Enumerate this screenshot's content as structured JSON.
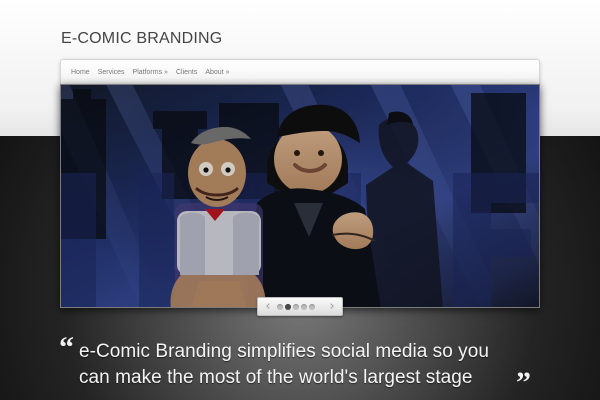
{
  "site": {
    "title": "E-COMIC BRANDING"
  },
  "nav": {
    "items": [
      {
        "label": "Home"
      },
      {
        "label": "Services"
      },
      {
        "label": "Platforms »"
      },
      {
        "label": "Clients"
      },
      {
        "label": "About »"
      }
    ]
  },
  "hero": {
    "alt": "Comedian on stage with a ventriloquist puppet"
  },
  "slider": {
    "prev_icon": "‹",
    "next_icon": "›",
    "dot_count": 5,
    "active_index": 1
  },
  "tagline": {
    "open_quote": "“",
    "line1": "e-Comic Branding simplifies social media so you",
    "line2": "can make the most of the world's largest stage",
    "close_quote": "”"
  },
  "colors": {
    "header_bg": "#f1f1f1",
    "body_dark": "#141414",
    "stage_blue": "#1d2f7a",
    "text_dark": "#444444",
    "text_light": "#f5f5f5"
  }
}
